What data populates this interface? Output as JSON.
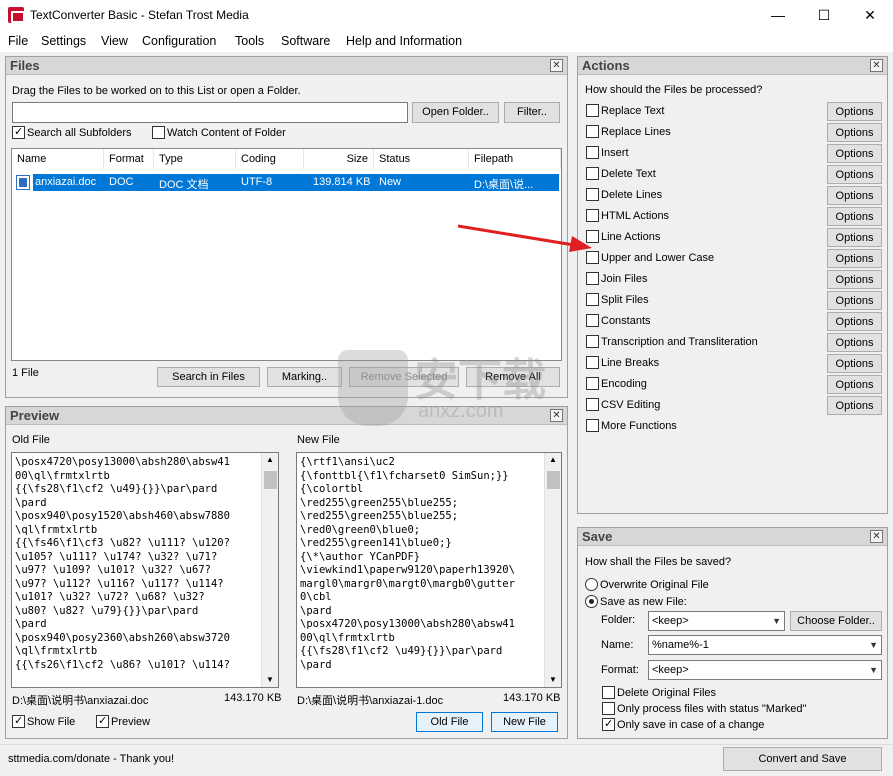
{
  "window": {
    "title": "TextConverter Basic - Stefan Trost Media",
    "controls": {
      "minimize": "—",
      "maximize": "☐",
      "close": "✕"
    }
  },
  "menu": [
    "File",
    "Settings",
    "View",
    "Configuration",
    "Tools",
    "Software",
    "Help and Information"
  ],
  "files": {
    "title": "Files",
    "hint": "Drag the Files to be worked on to this List or open a Folder.",
    "path_value": "",
    "open_folder": "Open Folder..",
    "filter": "Filter..",
    "search_subfolders": {
      "label": "Search all Subfolders",
      "checked": true
    },
    "watch_folder": {
      "label": "Watch Content of Folder",
      "checked": false
    },
    "columns": [
      "Name",
      "Format",
      "Type",
      "Coding",
      "Size",
      "Status",
      "Filepath"
    ],
    "rows": [
      {
        "name": "anxiazai.doc",
        "format": "DOC",
        "type": "DOC 文档",
        "coding": "UTF-8",
        "size": "139.814 KB",
        "status": "New",
        "filepath": "D:\\桌面\\说..."
      }
    ],
    "count": "1 File",
    "search_in_files": "Search in Files",
    "marking": "Marking..",
    "remove_selected": "Remove Selected",
    "remove_all": "Remove All"
  },
  "preview": {
    "title": "Preview",
    "old_label": "Old File",
    "new_label": "New File",
    "old_text": "\\posx4720\\posy13000\\absh280\\absw41\n00\\ql\\frmtxlrtb\n{{\\fs28\\f1\\cf2 \\u49}{}}\\par\\pard\n\\pard\n\\posx940\\posy1520\\absh460\\absw7880\n\\ql\\frmtxlrtb\n{{\\fs46\\f1\\cf3 \\u82? \\u111? \\u120?\n\\u105? \\u111? \\u174? \\u32? \\u71?\n\\u97? \\u109? \\u101? \\u32? \\u67?\n\\u97? \\u112? \\u116? \\u117? \\u114?\n\\u101? \\u32? \\u72? \\u68? \\u32?\n\\u80? \\u82? \\u79}{}}\\par\\pard\n\\pard\n\\posx940\\posy2360\\absh260\\absw3720\n\\ql\\frmtxlrtb\n{{\\fs26\\f1\\cf2 \\u86? \\u101? \\u114?",
    "new_text": "{\\rtf1\\ansi\\uc2\n{\\fonttbl{\\f1\\fcharset0 SimSun;}}\n{\\colortbl\n\\red255\\green255\\blue255;\n\\red255\\green255\\blue255;\n\\red0\\green0\\blue0;\n\\red255\\green141\\blue0;}\n{\\*\\author YCanPDF}\n\\viewkind1\\paperw9120\\paperh13920\\\nmargl0\\margr0\\margt0\\margb0\\gutter\n0\\cbl\n\\pard\n\\posx4720\\posy13000\\absh280\\absw41\n00\\ql\\frmtxlrtb\n{{\\fs28\\f1\\cf2 \\u49}{}}\\par\\pard\n\\pard",
    "old_path": "D:\\桌面\\说明书\\anxiazai.doc",
    "old_size": "143.170 KB",
    "new_path": "D:\\桌面\\说明书\\anxiazai-1.doc",
    "new_size": "143.170 KB",
    "show_file": {
      "label": "Show File",
      "checked": true
    },
    "preview_cb": {
      "label": "Preview",
      "checked": true
    },
    "old_file_btn": "Old File",
    "new_file_btn": "New File"
  },
  "actions": {
    "title": "Actions",
    "question": "How should the Files be processed?",
    "options_label": "Options",
    "items": [
      {
        "label": "Replace Text",
        "has_options": true
      },
      {
        "label": "Replace Lines",
        "has_options": true
      },
      {
        "label": "Insert",
        "has_options": true
      },
      {
        "label": "Delete Text",
        "has_options": true
      },
      {
        "label": "Delete Lines",
        "has_options": true
      },
      {
        "label": "HTML Actions",
        "has_options": true
      },
      {
        "label": "Line Actions",
        "has_options": true
      },
      {
        "label": "Upper and Lower Case",
        "has_options": true
      },
      {
        "label": "Join Files",
        "has_options": true
      },
      {
        "label": "Split Files",
        "has_options": true
      },
      {
        "label": "Constants",
        "has_options": true
      },
      {
        "label": "Transcription and Transliteration",
        "has_options": true
      },
      {
        "label": "Line Breaks",
        "has_options": true
      },
      {
        "label": "Encoding",
        "has_options": true
      },
      {
        "label": "CSV Editing",
        "has_options": true
      },
      {
        "label": "More Functions",
        "has_options": false
      }
    ]
  },
  "save": {
    "title": "Save",
    "question": "How shall the Files be saved?",
    "overwrite": {
      "label": "Overwrite Original File",
      "checked": false
    },
    "save_new": {
      "label": "Save as new File:",
      "checked": true
    },
    "folder_label": "Folder:",
    "folder_value": "<keep>",
    "choose_folder": "Choose Folder..",
    "name_label": "Name:",
    "name_value": "%name%-1",
    "format_label": "Format:",
    "format_value": "<keep>",
    "delete_original": {
      "label": "Delete Original Files",
      "checked": false
    },
    "only_marked": {
      "label": "Only process files with status \"Marked\"",
      "checked": false
    },
    "only_change": {
      "label": "Only save in case of a change",
      "checked": true
    }
  },
  "statusbar": {
    "donate": "sttmedia.com/donate - Thank you!",
    "convert": "Convert and Save"
  },
  "watermark": {
    "text": "安下载",
    "sub": "anxz.com"
  },
  "colors": {
    "selection": "#0078d7",
    "arrow": "#e02020"
  }
}
